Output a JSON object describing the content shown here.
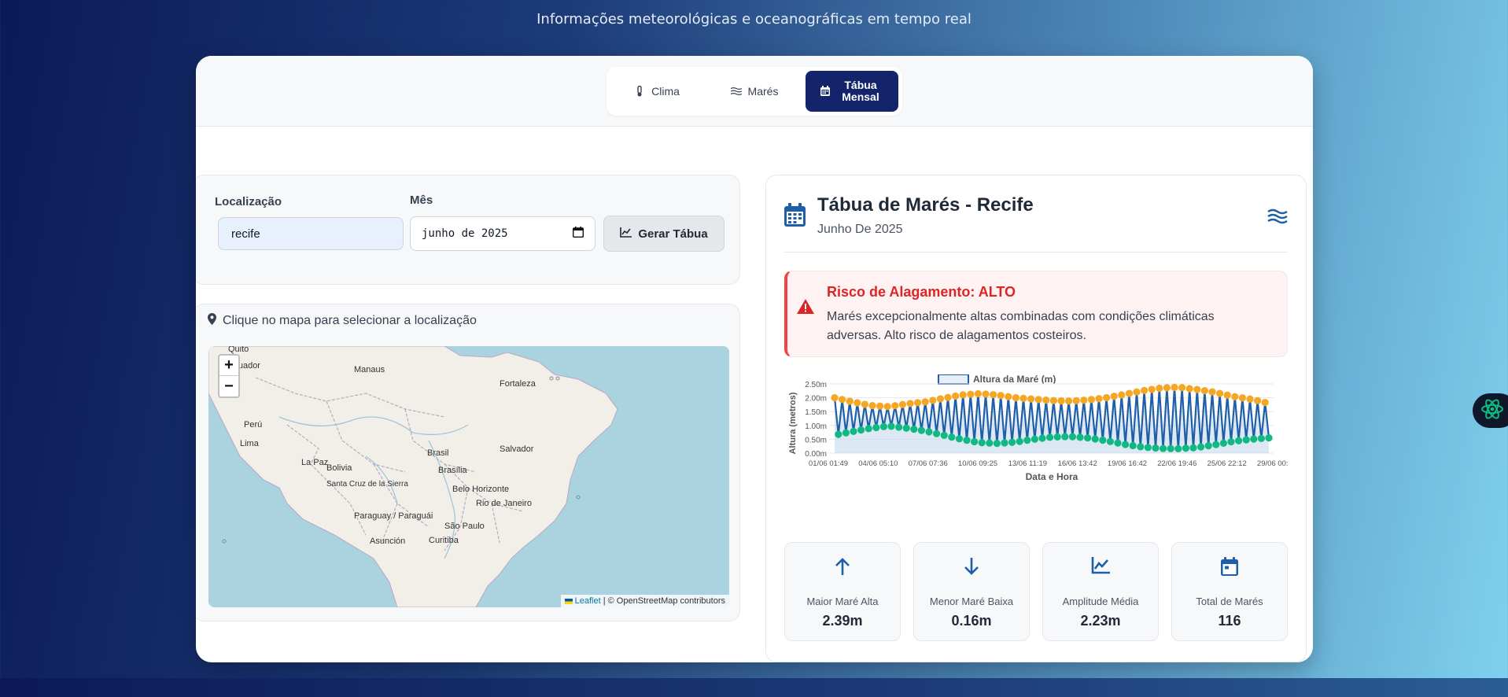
{
  "header": {
    "subtitle": "Informações meteorológicas e oceanográficas em tempo real"
  },
  "tabs": [
    {
      "label": "Clima",
      "icon": "thermometer-icon",
      "active": false
    },
    {
      "label": "Marés",
      "icon": "water-icon",
      "active": false
    },
    {
      "label": "Tábua Mensal",
      "icon": "calendar-icon",
      "active": true
    }
  ],
  "form": {
    "location_label": "Localização",
    "location_value": "recife",
    "month_label": "Mês",
    "month_value": "junho de 2025",
    "generate_button": "Gerar Tábua"
  },
  "map": {
    "hint": "Clique no mapa para selecionar a localização",
    "zoom_in": "+",
    "zoom_out": "−",
    "attribution_link": "Leaflet",
    "attribution_text": "| © OpenStreetMap contributors",
    "places": [
      "Quito",
      "Ecuador",
      "Manaus",
      "Fortaleza",
      "Perú",
      "Lima",
      "Brasil",
      "Salvador",
      "Bolivia",
      "La Paz",
      "Brasília",
      "Santa Cruz de la Sierra",
      "Belo Horizonte",
      "Rio de Janeiro",
      "Paraguay / Paraguái",
      "São Paulo",
      "Asunción",
      "Curitiba"
    ]
  },
  "tabua": {
    "title": "Tábua de Marés - Recife",
    "subtitle": "Junho De 2025",
    "alert_title": "Risco de Alagamento: ALTO",
    "alert_text": "Marés excepcionalmente altas combinadas com condições climáticas adversas. Alto risco de alagamentos costeiros."
  },
  "chart_data": {
    "type": "line",
    "legend": "Altura da Maré (m)",
    "xlabel": "Data e Hora",
    "ylabel": "Altura (metros)",
    "ylim": [
      0,
      2.5
    ],
    "yticks": [
      "0.00m",
      "0.50m",
      "1.00m",
      "1.50m",
      "2.00m",
      "2.50m"
    ],
    "xticks": [
      "01/06 01:49",
      "04/06 05:10",
      "07/06 07:36",
      "10/06 09:25",
      "13/06 11:19",
      "16/06 13:42",
      "19/06 16:42",
      "22/06 19:46",
      "25/06 22:12",
      "29/06 00:34"
    ],
    "colors": {
      "line": "#1f5fa8",
      "fill": "#c7d9ee",
      "high": "#f5a623",
      "low": "#10b981"
    },
    "n_points": 116,
    "high_envelope": [
      2.0,
      1.85,
      1.72,
      1.68,
      1.78,
      1.85,
      1.98,
      2.1,
      2.15,
      2.1,
      2.0,
      1.95,
      1.9,
      1.88,
      1.92,
      2.0,
      2.12,
      2.25,
      2.35,
      2.38,
      2.3,
      2.2,
      2.05,
      1.95,
      1.8
    ],
    "low_envelope": [
      0.65,
      0.78,
      0.9,
      0.98,
      0.9,
      0.8,
      0.65,
      0.5,
      0.38,
      0.35,
      0.4,
      0.5,
      0.58,
      0.6,
      0.55,
      0.45,
      0.32,
      0.22,
      0.17,
      0.16,
      0.2,
      0.3,
      0.42,
      0.5,
      0.55
    ]
  },
  "stats": [
    {
      "label": "Maior Maré Alta",
      "value": "2.39m",
      "icon": "arrow-up-icon"
    },
    {
      "label": "Menor Maré Baixa",
      "value": "0.16m",
      "icon": "arrow-down-icon"
    },
    {
      "label": "Amplitude Média",
      "value": "2.23m",
      "icon": "chart-line-icon"
    },
    {
      "label": "Total de Marés",
      "value": "116",
      "icon": "calendar-icon"
    }
  ]
}
